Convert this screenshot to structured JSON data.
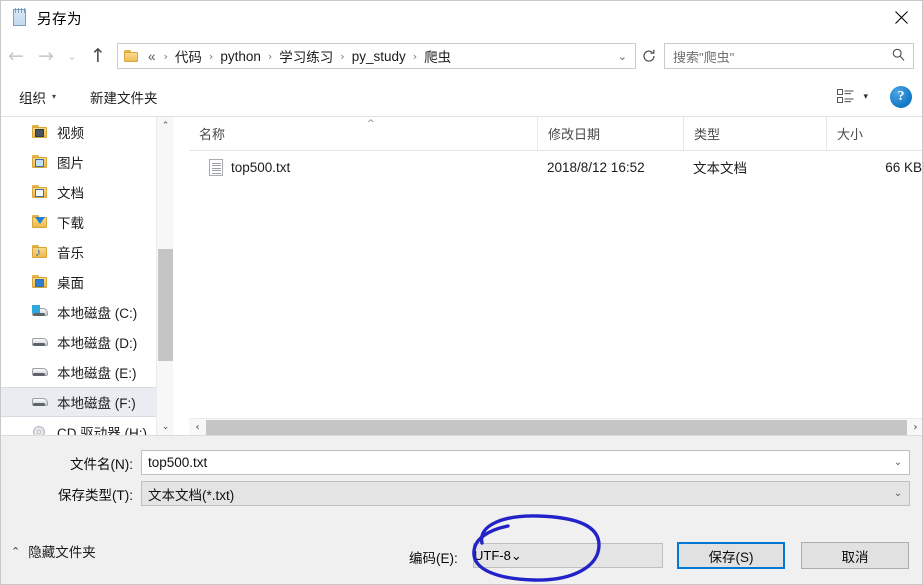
{
  "window": {
    "title": "另存为",
    "icon": "notepad-icon",
    "close_label": "✕"
  },
  "nav": {
    "back_icon": "arrow-left-icon",
    "forward_icon": "arrow-right-icon",
    "recent_icon": "chevron-down-icon",
    "up_icon": "arrow-up-icon",
    "refresh_icon": "refresh-icon",
    "address_dropdown_icon": "chevron-down-icon",
    "breadcrumb_lead": "«",
    "breadcrumbs": [
      "代码",
      "python",
      "学习练习",
      "py_study",
      "爬虫"
    ],
    "separator": "›"
  },
  "search": {
    "placeholder": "搜索\"爬虫\"",
    "icon": "search-icon"
  },
  "toolbar": {
    "organize_label": "组织",
    "organize_caret": "▾",
    "new_folder_label": "新建文件夹",
    "view_icon": "list-view-icon",
    "view_caret": "▾",
    "help_label": "?"
  },
  "sidebar": {
    "items": [
      {
        "label": "视频",
        "icon": "folder-videos-icon",
        "selected": false
      },
      {
        "label": "图片",
        "icon": "folder-pictures-icon",
        "selected": false
      },
      {
        "label": "文档",
        "icon": "folder-documents-icon",
        "selected": false
      },
      {
        "label": "下载",
        "icon": "folder-downloads-icon",
        "selected": false
      },
      {
        "label": "音乐",
        "icon": "folder-music-icon",
        "selected": false
      },
      {
        "label": "桌面",
        "icon": "folder-desktop-icon",
        "selected": false
      },
      {
        "label": "本地磁盘 (C:)",
        "icon": "drive-system-icon",
        "selected": false
      },
      {
        "label": "本地磁盘 (D:)",
        "icon": "drive-icon",
        "selected": false
      },
      {
        "label": "本地磁盘 (E:)",
        "icon": "drive-icon",
        "selected": false
      },
      {
        "label": "本地磁盘 (F:)",
        "icon": "drive-icon",
        "selected": true
      },
      {
        "label": "CD 驱动器 (H:)",
        "icon": "cd-drive-icon",
        "selected": false
      }
    ],
    "scroll_up_icon": "chevron-up-icon",
    "scroll_down_icon": "chevron-down-icon"
  },
  "filelist": {
    "columns": [
      {
        "label": "名称",
        "sorted": true,
        "sort_caret": "^"
      },
      {
        "label": "修改日期",
        "sorted": false
      },
      {
        "label": "类型",
        "sorted": false
      },
      {
        "label": "大小",
        "sorted": false
      }
    ],
    "rows": [
      {
        "name": "top500.txt",
        "icon": "text-file-icon",
        "modified": "2018/8/12 16:52",
        "type": "文本文档",
        "size": "66 KB"
      }
    ],
    "hscroll_left_icon": "chevron-left-icon",
    "hscroll_right_icon": "chevron-right-icon"
  },
  "form": {
    "filename_label": "文件名(N):",
    "filename_value": "top500.txt",
    "filename_dropdown_icon": "chevron-down-icon",
    "filetype_label": "保存类型(T):",
    "filetype_value": "文本文档(*.txt)",
    "filetype_dropdown_icon": "chevron-down-icon"
  },
  "footer": {
    "hide_folders_label": "隐藏文件夹",
    "hide_folders_icon": "chevron-up-icon",
    "encoding_label": "编码(E):",
    "encoding_value": "UTF-8",
    "encoding_dropdown_icon": "chevron-down-icon",
    "save_label": "保存(S)",
    "cancel_label": "取消"
  },
  "annotation": {
    "shape": "hand-drawn-ellipse",
    "color": "#2222c8",
    "target": "encoding-combobox"
  },
  "colors": {
    "accent": "#0078d7",
    "window_bg": "#ffffff",
    "panel_bg": "#f0f0f0",
    "selection": "#e9edf2",
    "annotation": "#2222c8"
  }
}
